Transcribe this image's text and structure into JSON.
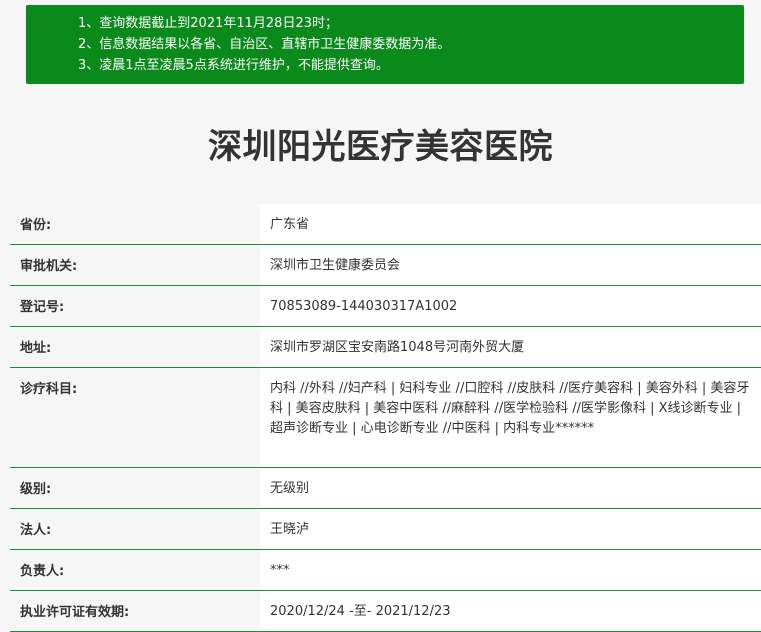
{
  "notice": {
    "lines": [
      "1、查询数据截止到2021年11月28日23时；",
      "2、信息数据结果以各省、自治区、直辖市卫生健康委数据为准。",
      "3、凌晨1点至凌晨5点系统进行维护，不能提供查询。"
    ]
  },
  "hospital": {
    "name": "深圳阳光医疗美容医院"
  },
  "fields": [
    {
      "label": "省份:",
      "value": "广东省"
    },
    {
      "label": "审批机关:",
      "value": "深圳市卫生健康委员会"
    },
    {
      "label": "登记号:",
      "value": "70853089-144030317A1002"
    },
    {
      "label": "地址:",
      "value": "深圳市罗湖区宝安南路1048号河南外贸大厦"
    },
    {
      "label": "诊疗科目:",
      "value": "内科 //外科 //妇产科 | 妇科专业 //口腔科 //皮肤科 //医疗美容科 | 美容外科 | 美容牙科 | 美容皮肤科 | 美容中医科 //麻醉科 //医学检验科 //医学影像科 | X线诊断专业 | 超声诊断专业 | 心电诊断专业 //中医科 | 内科专业******"
    },
    {
      "label": "级别:",
      "value": "无级别"
    },
    {
      "label": "法人:",
      "value": "王晓泸"
    },
    {
      "label": "负责人:",
      "value": "***"
    },
    {
      "label": "执业许可证有效期:",
      "value": "2020/12/24 -至- 2021/12/23"
    }
  ],
  "colors": {
    "notice_bg": "#0a8a1b",
    "row_border": "#1e8c3a",
    "page_bg": "#f6f6f6"
  }
}
